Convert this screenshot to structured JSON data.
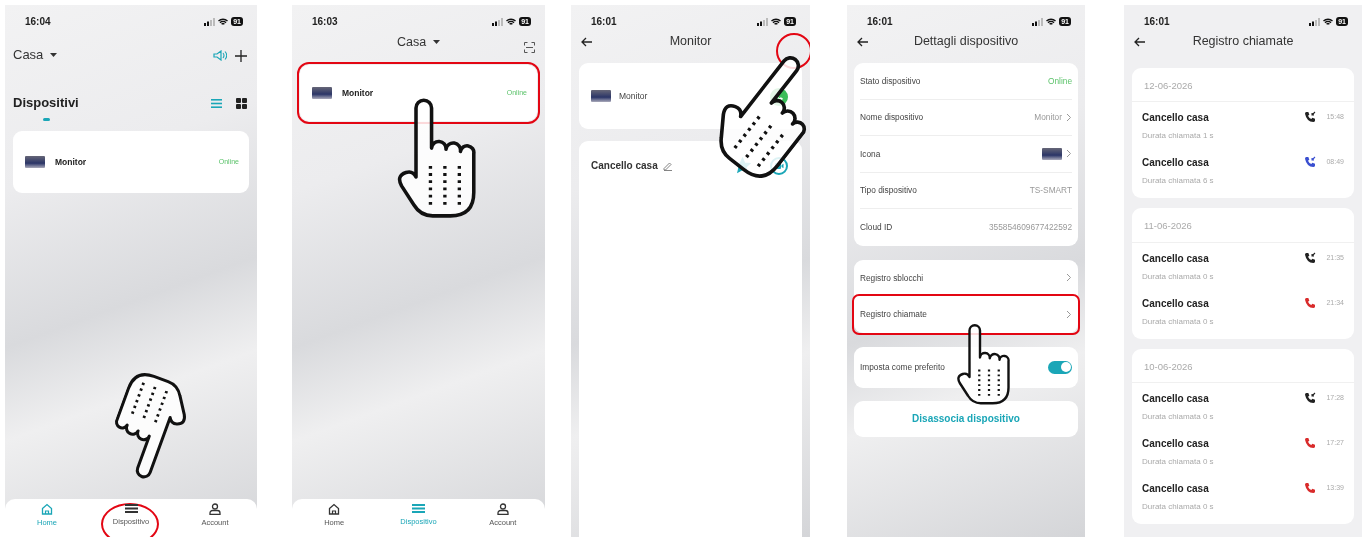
{
  "home_screen": {
    "status_bar": {
      "time": "16:04",
      "battery": "91"
    },
    "home_name": "Casa",
    "section_title": "Dispositivi",
    "view_modes": [
      {
        "kind": "list",
        "selected": true
      },
      {
        "kind": "grid",
        "selected": false
      }
    ],
    "devices": [
      {
        "name": "Monitor",
        "status": "Online",
        "highlighted": false
      }
    ],
    "nav": [
      {
        "label": "Home",
        "kind": "home",
        "selected": true,
        "highlighted": false
      },
      {
        "label": "Dispositivo",
        "kind": "devices",
        "selected": false,
        "highlighted": true
      },
      {
        "label": "Account",
        "kind": "account",
        "selected": false,
        "highlighted": false
      }
    ]
  },
  "devices_screen": {
    "status_bar": {
      "time": "16:03",
      "battery": "91"
    },
    "home_name": "Casa",
    "devices": [
      {
        "name": "Monitor",
        "status": "Online",
        "highlighted": true
      }
    ],
    "nav": [
      {
        "label": "Home",
        "kind": "home",
        "selected": false,
        "highlighted": false
      },
      {
        "label": "Dispositivo",
        "kind": "devices",
        "selected": true,
        "highlighted": false
      },
      {
        "label": "Account",
        "kind": "account",
        "selected": false,
        "highlighted": false
      }
    ]
  },
  "monitor_screen": {
    "status_bar": {
      "time": "16:01",
      "battery": "91"
    },
    "title": "Monitor",
    "header_action": {
      "highlighted": true
    },
    "device": {
      "name": "Monitor"
    },
    "door": {
      "name": "Cancello casa",
      "favorite": true
    }
  },
  "details_screen": {
    "status_bar": {
      "time": "16:01",
      "battery": "91"
    },
    "title": "Dettagli dispositivo",
    "info_rows": [
      {
        "label": "Stato dispositivo",
        "value": "Online",
        "kind": "status"
      },
      {
        "label": "Nome dispositivo",
        "value": "Monitor",
        "kind": "link"
      },
      {
        "label": "Icona",
        "kind": "image"
      },
      {
        "label": "Tipo dispositivo",
        "value": "TS-SMART",
        "kind": "plain"
      },
      {
        "label": "Cloud ID",
        "value": "355854609677422592",
        "kind": "plain"
      }
    ],
    "log_rows": [
      {
        "label": "Registro sblocchi",
        "highlighted": false
      },
      {
        "label": "Registro chiamate",
        "highlighted": true
      }
    ],
    "favorite": {
      "label": "Imposta come preferito",
      "on": true
    },
    "unbind_button": "Disassocia dispositivo"
  },
  "call_log_screen": {
    "status_bar": {
      "time": "16:01",
      "battery": "91"
    },
    "title": "Registro chiamate",
    "days": [
      {
        "date": "12-06-2026",
        "calls": [
          {
            "name": "Cancello casa",
            "duration": "Durata chiamata 1 s",
            "time": "15:48",
            "kind": "answered"
          },
          {
            "name": "Cancello casa",
            "duration": "Durata chiamata 6 s",
            "time": "08:49",
            "kind": "outgoing"
          }
        ]
      },
      {
        "date": "11-06-2026",
        "calls": [
          {
            "name": "Cancello casa",
            "duration": "Durata chiamata 0 s",
            "time": "21:35",
            "kind": "answered"
          },
          {
            "name": "Cancello casa",
            "duration": "Durata chiamata 0 s",
            "time": "21:34",
            "kind": "missed"
          }
        ]
      },
      {
        "date": "10-06-2026",
        "calls": [
          {
            "name": "Cancello casa",
            "duration": "Durata chiamata 0 s",
            "time": "17:28",
            "kind": "answered"
          },
          {
            "name": "Cancello casa",
            "duration": "Durata chiamata 0 s",
            "time": "17:27",
            "kind": "missed"
          },
          {
            "name": "Cancello casa",
            "duration": "Durata chiamata 0 s",
            "time": "13:39",
            "kind": "missed"
          }
        ]
      }
    ]
  }
}
